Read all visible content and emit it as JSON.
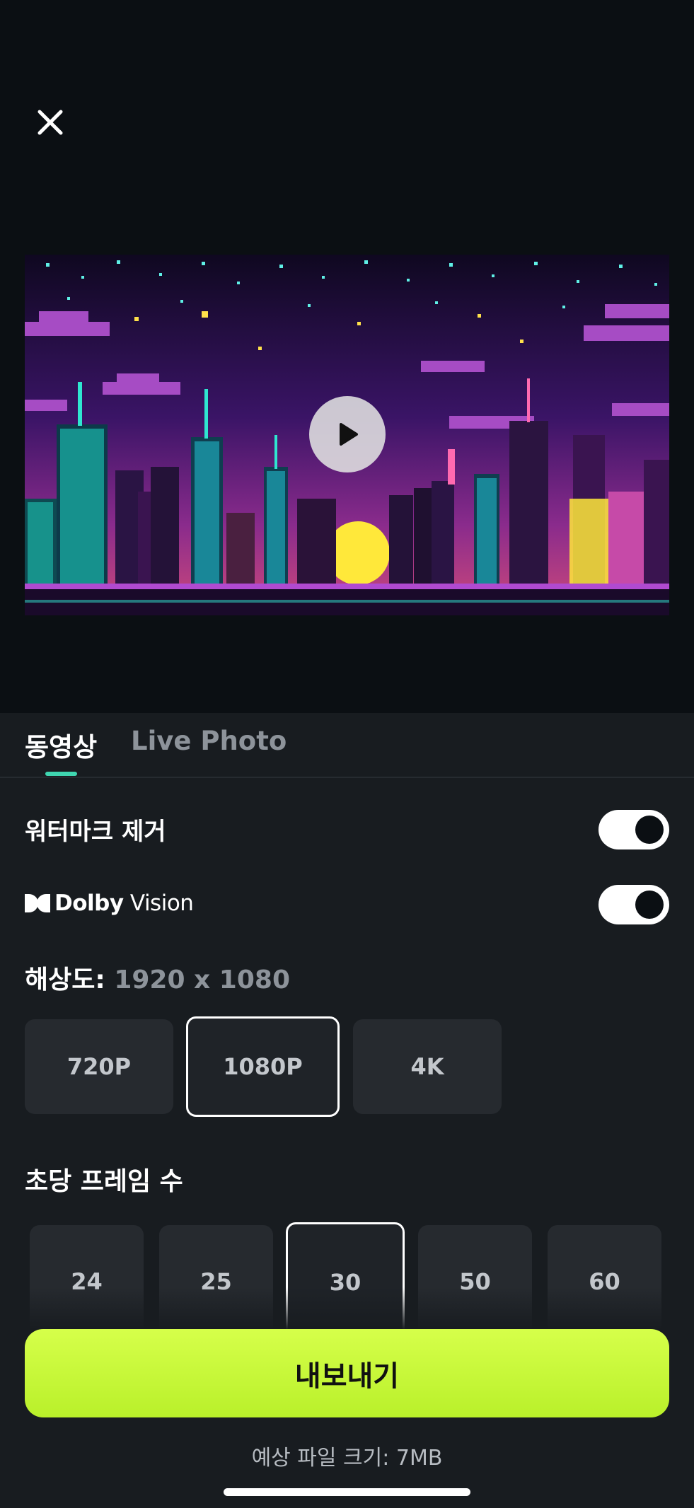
{
  "tabs": [
    {
      "label": "동영상",
      "active": true
    },
    {
      "label": "Live Photo",
      "active": false
    }
  ],
  "settings": {
    "watermark_label": "워터마크 제거",
    "watermark_on": true,
    "dolby_logo_text_bold": "Dolby",
    "dolby_logo_text_light": "Vision",
    "dolby_on": true
  },
  "resolution": {
    "label": "해상도:",
    "value": "1920 x 1080",
    "options": [
      "720P",
      "1080P",
      "4K"
    ],
    "selected": "1080P"
  },
  "fps": {
    "label": "초당 프레임 수",
    "options": [
      "24",
      "25",
      "30",
      "50",
      "60"
    ],
    "selected": "30"
  },
  "export": {
    "button_label": "내보내기",
    "file_size_text": "예상 파일 크기: 7MB"
  },
  "colors": {
    "accent": "#3fd6b0",
    "export_button": "#c8f83a",
    "background": "#0b0f13",
    "sheet": "#181c20"
  },
  "icons": {
    "close": "close-icon",
    "play": "play-icon",
    "dolby": "dolby-logo-icon"
  }
}
